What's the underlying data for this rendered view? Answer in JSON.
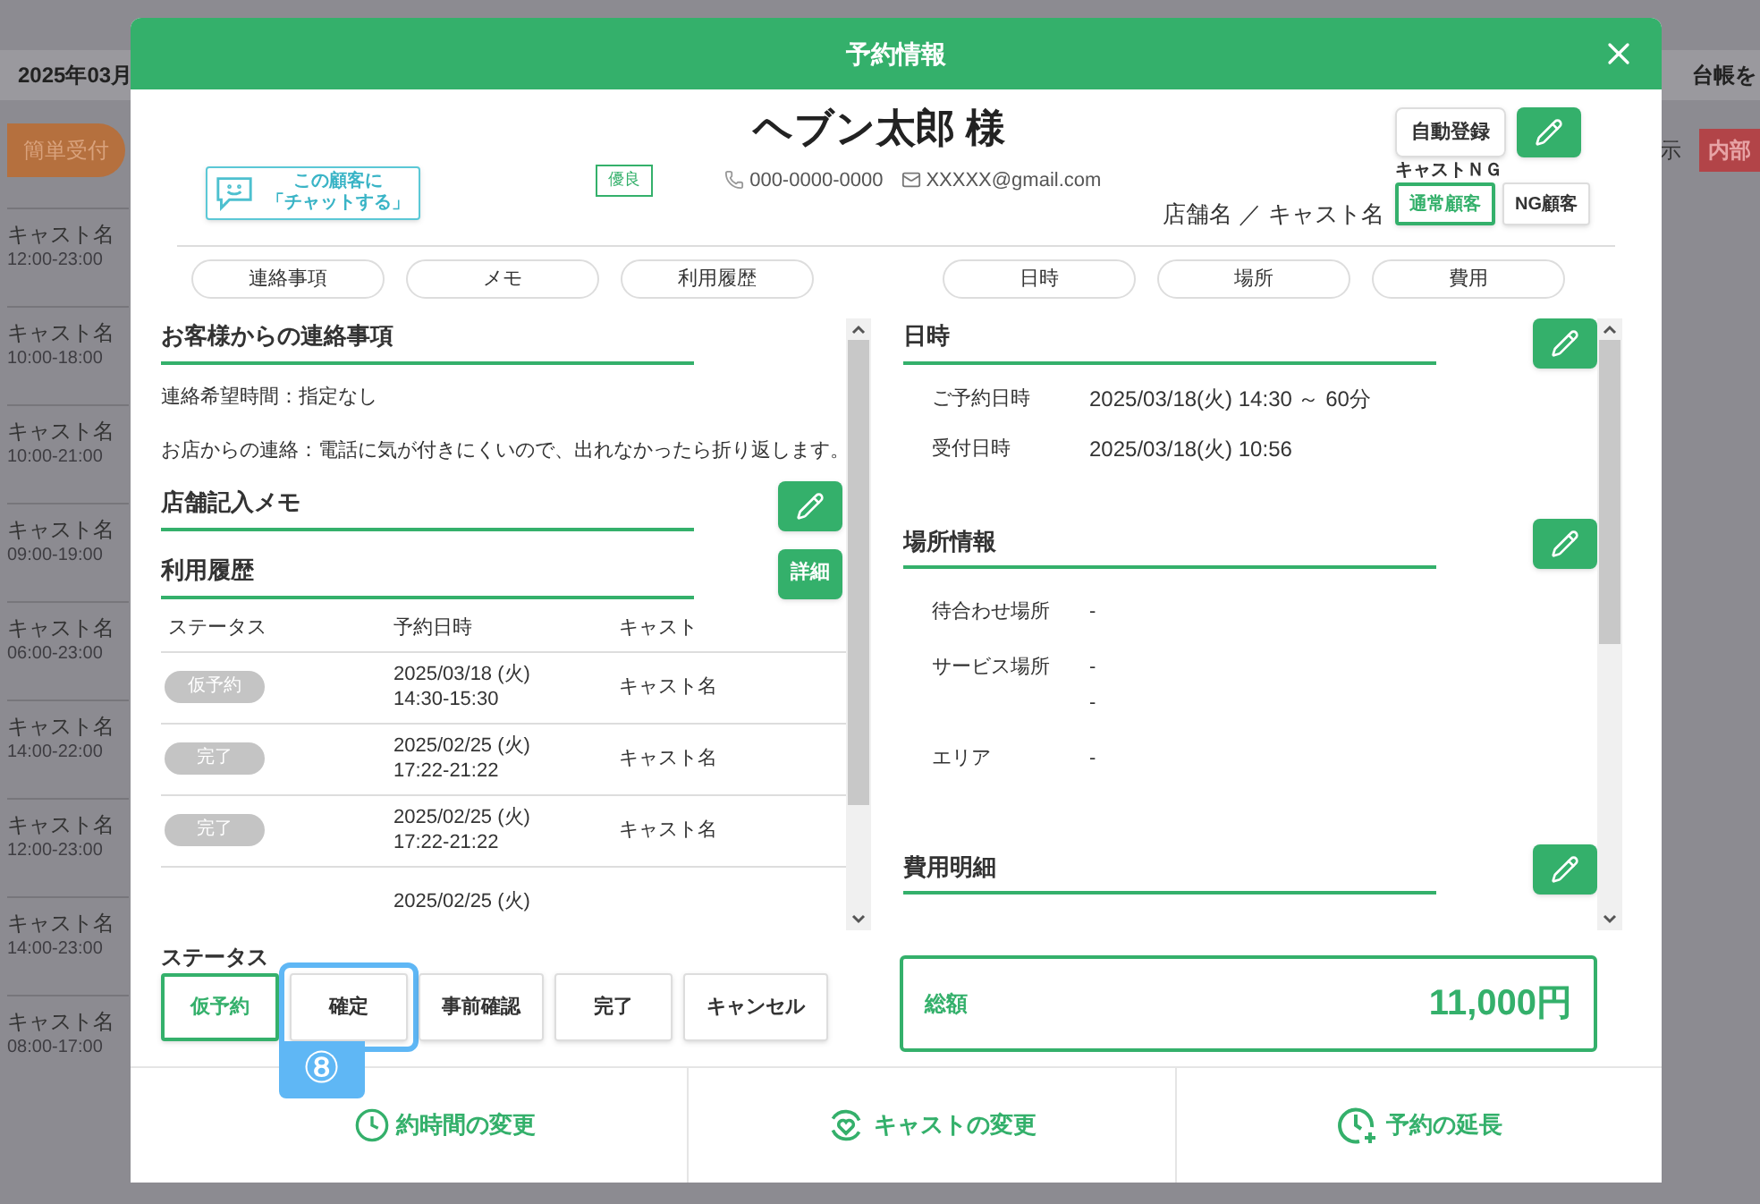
{
  "background": {
    "month": "2025年03月",
    "quick_button": "簡単受付",
    "ledger_button": "台帳を",
    "tab_fragment": "示",
    "red_button": "内部",
    "staff": [
      {
        "name": "キャスト名",
        "hours": "12:00-23:00"
      },
      {
        "name": "キャスト名",
        "hours": "10:00-18:00"
      },
      {
        "name": "キャスト名",
        "hours": "10:00-21:00"
      },
      {
        "name": "キャスト名",
        "hours": "09:00-19:00"
      },
      {
        "name": "キャスト名",
        "hours": "06:00-23:00"
      },
      {
        "name": "キャスト名",
        "hours": "14:00-22:00"
      },
      {
        "name": "キャスト名",
        "hours": "12:00-23:00"
      },
      {
        "name": "キャスト名",
        "hours": "14:00-23:00"
      },
      {
        "name": "キャスト名",
        "hours": "08:00-17:00"
      }
    ]
  },
  "modal": {
    "title": "予約情報",
    "customer": {
      "name": "ヘブン太郎 様",
      "chat_button": [
        "この顧客に",
        "「チャットする」"
      ],
      "badge": "優良",
      "phone": "000-0000-0000",
      "email": "XXXXX@gmail.com",
      "auto_register": "自動登録",
      "store_cast": "店舗名 ／ キャスト名",
      "cast_ng_label": "キャストＮＧ",
      "ng_options": [
        {
          "label": "通常顧客",
          "selected": true
        },
        {
          "label": "NG顧客",
          "selected": false
        }
      ]
    },
    "tabs_left": [
      "連絡事項",
      "メモ",
      "利用履歴"
    ],
    "tabs_right": [
      "日時",
      "場所",
      "費用"
    ],
    "contact": {
      "title": "お客様からの連絡事項",
      "lines": [
        "連絡希望時間：指定なし",
        "お店からの連絡：電話に気が付きにくいので、出れなかったら折り返します。"
      ]
    },
    "memo": {
      "title": "店舗記入メモ"
    },
    "history": {
      "title": "利用履歴",
      "detail_button": "詳細",
      "columns": [
        "ステータス",
        "予約日時",
        "キャスト"
      ],
      "rows": [
        {
          "status": "仮予約",
          "date": "2025/03/18 (火)",
          "time": "14:30-15:30",
          "cast": "キャスト名"
        },
        {
          "status": "完了",
          "date": "2025/02/25 (火)",
          "time": "17:22-21:22",
          "cast": "キャスト名"
        },
        {
          "status": "完了",
          "date": "2025/02/25 (火)",
          "time": "17:22-21:22",
          "cast": "キャスト名"
        },
        {
          "date": "2025/02/25 (火)"
        }
      ]
    },
    "datetime": {
      "title": "日時",
      "rows": [
        {
          "label": "ご予約日時",
          "value": "2025/03/18(火) 14:30 ～ 60分"
        },
        {
          "label": "受付日時",
          "value": "2025/03/18(火) 10:56"
        }
      ]
    },
    "place": {
      "title": "場所情報",
      "rows": [
        {
          "label": "待合わせ場所",
          "values": [
            "-"
          ]
        },
        {
          "label": "サービス場所",
          "values": [
            "-",
            "-"
          ]
        },
        {
          "label": "エリア",
          "values": [
            "-"
          ]
        }
      ]
    },
    "cost": {
      "title": "費用明細"
    },
    "status": {
      "label": "ステータス",
      "options": [
        {
          "label": "仮予約",
          "selected": true,
          "highlighted": false
        },
        {
          "label": "確定",
          "selected": false,
          "highlighted": true
        },
        {
          "label": "事前確認",
          "selected": false,
          "highlighted": false
        },
        {
          "label": "完了",
          "selected": false,
          "highlighted": false
        },
        {
          "label": "キャンセル",
          "selected": false,
          "highlighted": false
        }
      ]
    },
    "total": {
      "label": "総額",
      "value": "11,000円"
    },
    "footer": [
      {
        "kind": "time",
        "label": "約時間の変更"
      },
      {
        "kind": "cast",
        "label": "キャストの変更"
      },
      {
        "kind": "extend",
        "label": "予約の延長"
      }
    ],
    "annotation": {
      "number": "⑧"
    }
  }
}
